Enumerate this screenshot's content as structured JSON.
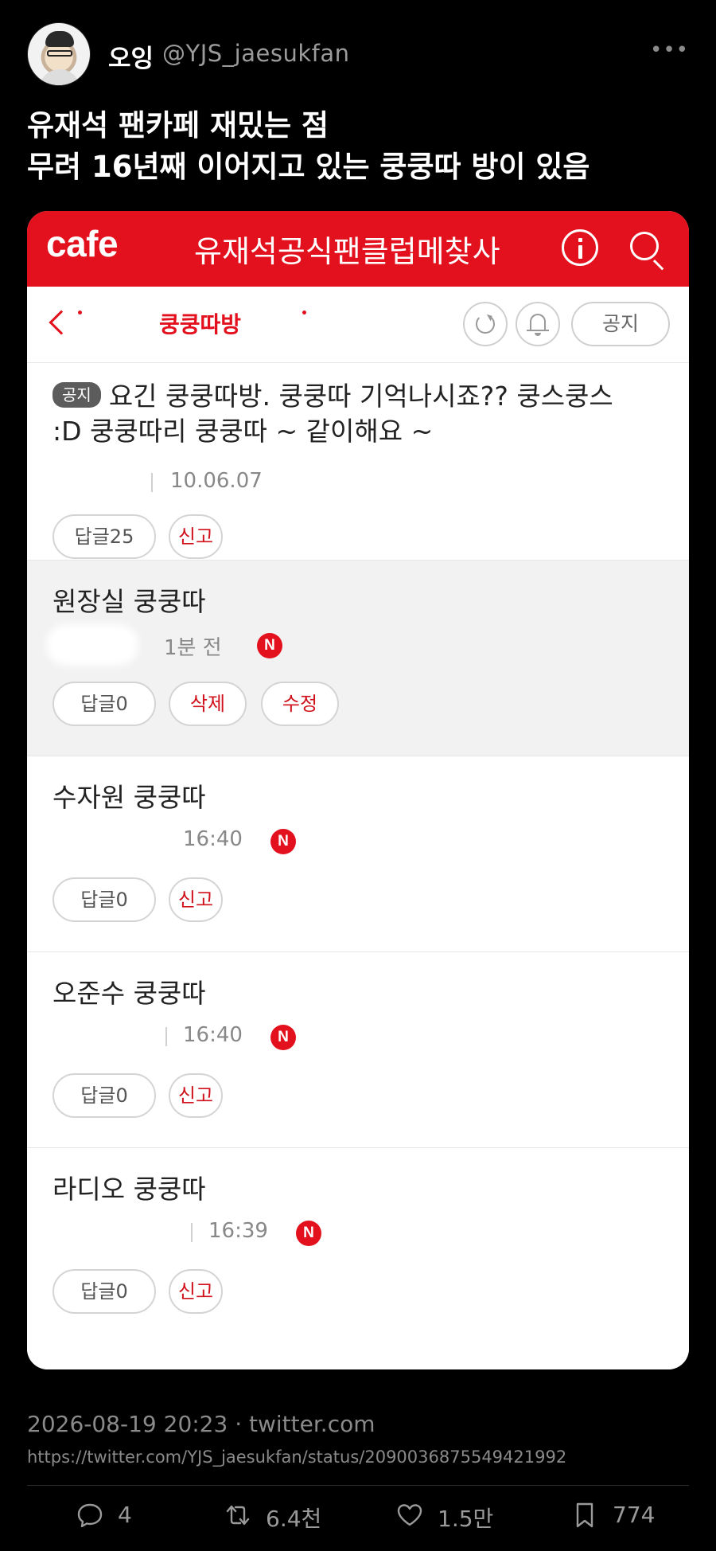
{
  "tweet": {
    "display_name": "오잉",
    "handle": "@YJS_jaesukfan",
    "more_label": "•••",
    "text_lines": [
      "유재석 팬카페 재밌는 점",
      "무려 16년째 이어지고 있는 쿵쿵따 방이 있음"
    ],
    "date": "2026-08-19 20:23 · twitter.com",
    "url": "https://twitter.com/YJS_jaesukfan/status/2090036875549421992",
    "stats": {
      "replies": "4",
      "retweets": "6.4천",
      "likes": "1.5만",
      "bookmarks": "774"
    }
  },
  "cafe": {
    "logo": "cafe",
    "title": "유재석공식팬클럽메찾사",
    "board_name": "쿵쿵따방",
    "notice_button": "공지",
    "posts": [
      {
        "badge": "공지",
        "title_line1": "요긴 쿵쿵따방. 쿵쿵따 기억나시죠?? 쿵스쿵스",
        "title_line2": ":D 쿵쿵따리 쿵쿵따 ~ 같이해요 ~",
        "time": "10.06.07",
        "reply_button": "답글25",
        "report_button": "신고"
      },
      {
        "title": "원장실 쿵쿵따",
        "time": "1분 전",
        "new_badge": "N",
        "reply_button": "답글0",
        "delete_button": "삭제",
        "edit_button": "수정"
      },
      {
        "title": "수자원 쿵쿵따",
        "time": "16:40",
        "new_badge": "N",
        "reply_button": "답글0",
        "report_button": "신고"
      },
      {
        "title": "오준수 쿵쿵따",
        "time": "16:40",
        "new_badge": "N",
        "reply_button": "답글0",
        "report_button": "신고"
      },
      {
        "title": "라디오 쿵쿵따",
        "time": "16:39",
        "new_badge": "N",
        "reply_button": "답글0",
        "report_button": "신고"
      }
    ]
  },
  "colors": {
    "background": "#000000",
    "cafe_red": "#e3111e",
    "muted_text": "#8a8a8a"
  }
}
